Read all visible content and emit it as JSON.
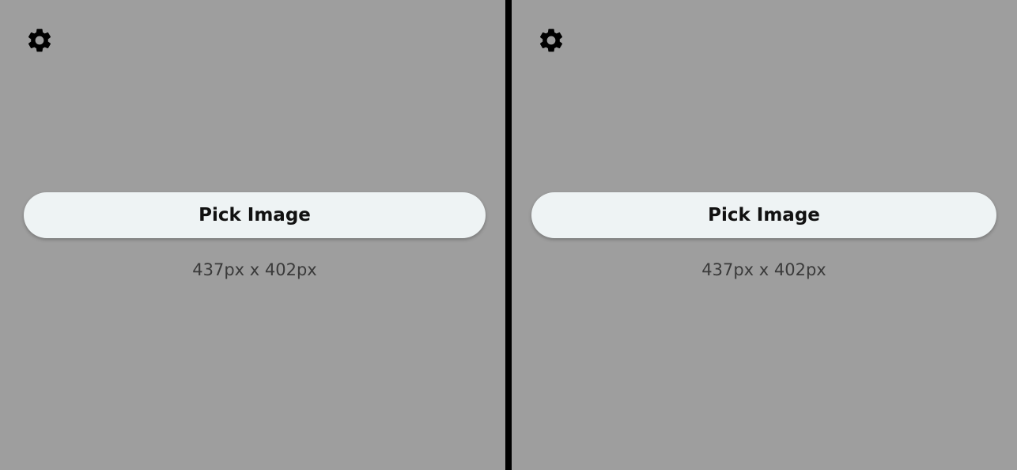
{
  "panels": [
    {
      "settings_icon": "gear-icon",
      "pick_button_label": "Pick Image",
      "image_size_text": "437px x 402px"
    },
    {
      "settings_icon": "gear-icon",
      "pick_button_label": "Pick Image",
      "image_size_text": "437px x 402px"
    }
  ],
  "colors": {
    "background": "#9e9e9e",
    "divider": "#000000",
    "button_background": "#eef3f4",
    "button_text": "#111111",
    "label_text": "#3a3a3a"
  }
}
